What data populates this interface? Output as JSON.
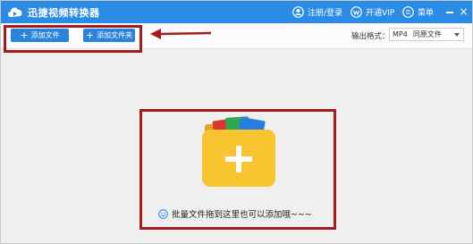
{
  "app": {
    "title": "迅捷视频转换器"
  },
  "titlebar": {
    "login_label": "注册/登录",
    "vip_label": "开通VIP",
    "menu_label": "菜单"
  },
  "toolbar": {
    "add_file_label": "添加文件",
    "add_folder_label": "添加文件夹",
    "format_label": "输出格式：",
    "format_value": "MP4",
    "quality_value": "同原文件"
  },
  "drop_zone": {
    "hint": "批量文件拖到这里也可以添加哦~~~"
  },
  "colors": {
    "title_bar": "#2b8ce6",
    "button": "#2a84de",
    "annotation_red": "#a51c1f",
    "folder_yellow": "#f8c531"
  }
}
